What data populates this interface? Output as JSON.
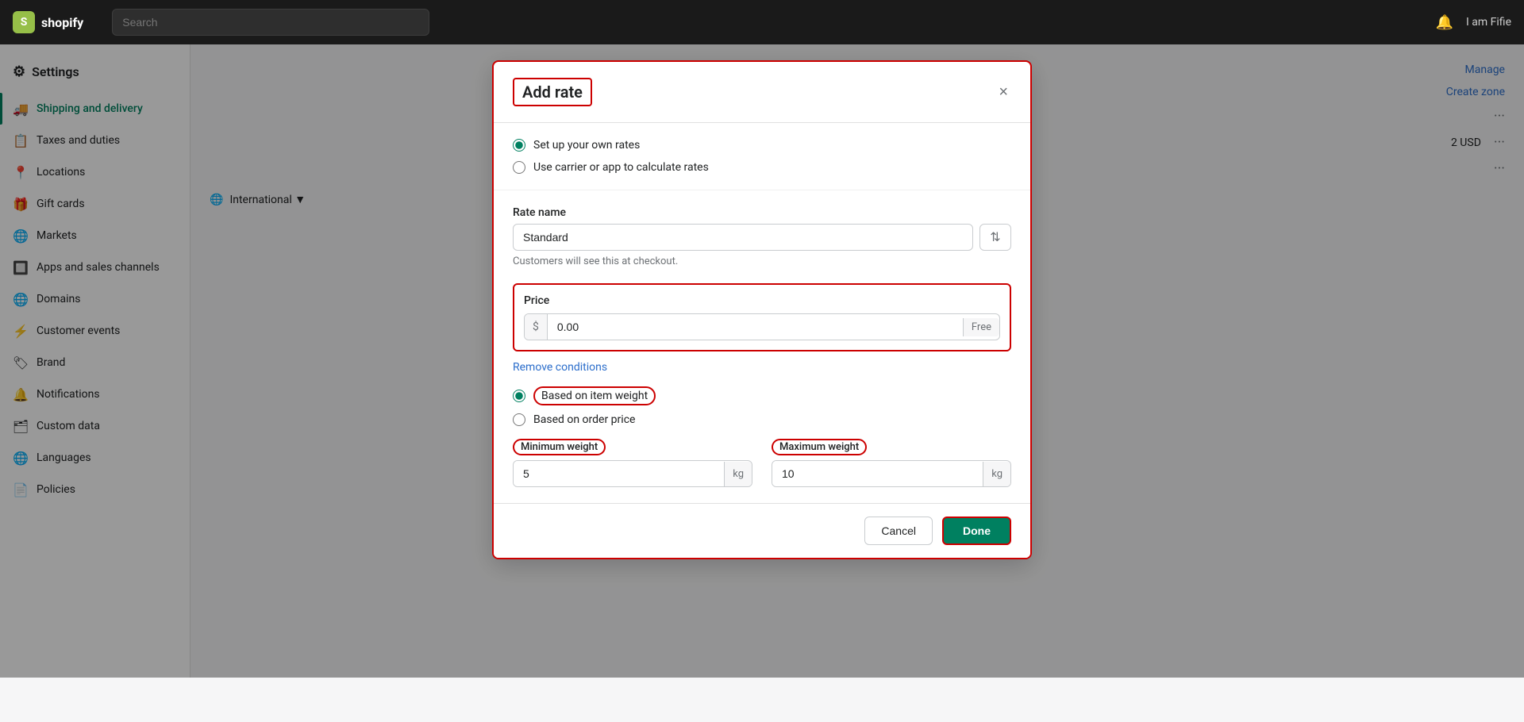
{
  "app": {
    "logo_text": "shopify",
    "settings_label": "Settings"
  },
  "topnav": {
    "search_placeholder": "Search"
  },
  "sidebar": {
    "items": [
      {
        "id": "shipping",
        "label": "Shipping and delivery",
        "icon": "🚚",
        "active": true
      },
      {
        "id": "taxes",
        "label": "Taxes and duties",
        "icon": "📋"
      },
      {
        "id": "locations",
        "label": "Locations",
        "icon": "📍"
      },
      {
        "id": "gift-cards",
        "label": "Gift cards",
        "icon": "🎁"
      },
      {
        "id": "markets",
        "label": "Markets",
        "icon": "🌐"
      },
      {
        "id": "apps",
        "label": "Apps and sales channels",
        "icon": "🔲"
      },
      {
        "id": "domains",
        "label": "Domains",
        "icon": "🌐"
      },
      {
        "id": "customer-events",
        "label": "Customer events",
        "icon": "⚡"
      },
      {
        "id": "brand",
        "label": "Brand",
        "icon": "🏷"
      },
      {
        "id": "notifications",
        "label": "Notifications",
        "icon": "🔔"
      },
      {
        "id": "custom-data",
        "label": "Custom data",
        "icon": "🗂"
      },
      {
        "id": "languages",
        "label": "Languages",
        "icon": "🌐"
      },
      {
        "id": "policies",
        "label": "Policies",
        "icon": "📄"
      }
    ]
  },
  "modal": {
    "title": "Add rate",
    "close_label": "×",
    "rate_options": [
      {
        "id": "own-rates",
        "label": "Set up your own rates",
        "checked": true
      },
      {
        "id": "carrier-rates",
        "label": "Use carrier or app to calculate rates",
        "checked": false
      }
    ],
    "rate_name": {
      "label": "Rate name",
      "value": "Standard",
      "helper": "Customers will see this at checkout."
    },
    "price": {
      "label": "Price",
      "currency_symbol": "$",
      "value": "0.00",
      "free_badge": "Free"
    },
    "remove_conditions_label": "Remove conditions",
    "condition_types": [
      {
        "id": "item-weight",
        "label": "Based on item weight",
        "checked": true
      },
      {
        "id": "order-price",
        "label": "Based on order price",
        "checked": false
      }
    ],
    "minimum_weight": {
      "label": "Minimum weight",
      "value": "5",
      "unit": "kg"
    },
    "maximum_weight": {
      "label": "Maximum weight",
      "value": "10",
      "unit": "kg"
    },
    "cancel_label": "Cancel",
    "done_label": "Done"
  },
  "background": {
    "manage_label": "Manage",
    "create_zone_label": "Create zone",
    "dots": "···",
    "usd_label": "2 USD",
    "international_label": "International ▼"
  }
}
